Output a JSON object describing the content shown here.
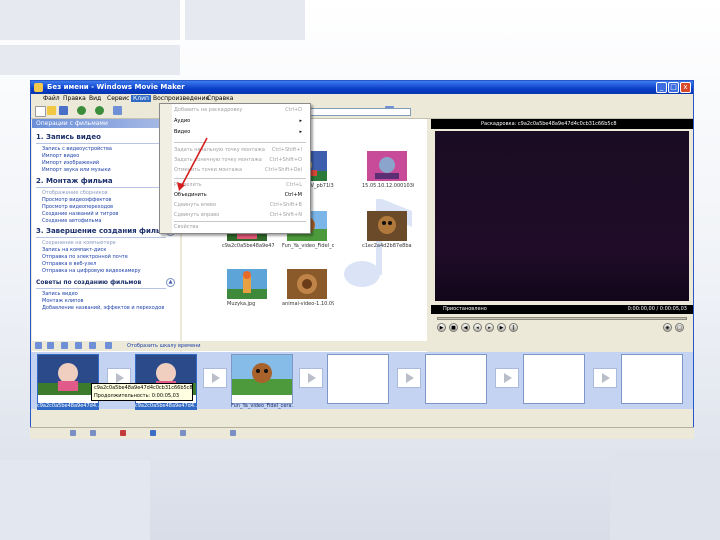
{
  "window": {
    "title": "Без имени - Windows Movie Maker",
    "buttons": [
      "_",
      "□",
      "x"
    ]
  },
  "menu": [
    "Файл",
    "Правка",
    "Вид",
    "Сервис",
    "Клип",
    "Воспроизведение",
    "Справка"
  ],
  "tasks": {
    "header": "Операции с фильмами",
    "sections": [
      {
        "title": "1. Запись видео",
        "items": [
          "Запись с видеоустройства",
          "Импорт видео",
          "Импорт изображений",
          "Импорт звука или музыки"
        ]
      },
      {
        "title": "2. Монтаж фильма",
        "items": [
          "Отображение сборников",
          "Просмотр видеоэффектов",
          "Просмотр видеопереходов",
          "Создание названий и титров",
          "Создание автофильма"
        ]
      },
      {
        "title": "3. Завершение создания фильма",
        "items": [
          "Сохранение на компьютере",
          "Запись на компакт-диск",
          "Отправка по электронной почте",
          "Отправка в веб-узел",
          "Отправка на цифровую видеокамеру"
        ]
      },
      {
        "title": "Советы по созданию фильмов",
        "items": [
          "Запись видео",
          "Монтаж клипов",
          "Добавление названий, эффектов и переходов"
        ]
      }
    ]
  },
  "dropdown": {
    "items": [
      {
        "label": "Добавить на раскадровку",
        "shortcut": "Ctrl+D",
        "disabled": true
      },
      {
        "label": "Аудио",
        "shortcut": "▸",
        "disabled": false
      },
      {
        "label": "Видео",
        "shortcut": "▸",
        "disabled": false
      },
      {
        "label": "Задать начальную точку монтажа",
        "shortcut": "Ctrl+Shift+I",
        "disabled": true
      },
      {
        "label": "Задать конечную точку монтажа",
        "shortcut": "Ctrl+Shift+O",
        "disabled": true
      },
      {
        "label": "Отменить точки монтажа",
        "shortcut": "Ctrl+Shift+Del",
        "disabled": true
      },
      {
        "label": "Разделить",
        "shortcut": "Ctrl+L",
        "disabled": true
      },
      {
        "label": "Объединить",
        "shortcut": "Ctrl+M",
        "disabled": false
      },
      {
        "label": "Сдвинуть влево",
        "shortcut": "Ctrl+Shift+B",
        "disabled": true
      },
      {
        "label": "Сдвинуть вправо",
        "shortcut": "Ctrl+Shift+N",
        "disabled": true
      },
      {
        "label": "Свойства",
        "shortcut": "",
        "disabled": true
      }
    ]
  },
  "collection": {
    "clips": [
      {
        "label": "sQoN2bV0LV_pb71l3_pl"
      },
      {
        "label": "15.05.10.12.00010303"
      },
      {
        "label": "c9a2c0a5be48a9e47d4c0cb31c66"
      },
      {
        "label": "Fun_Ya_video_Fidel_ch3"
      },
      {
        "label": "c1ec2a4d2b87e8ba"
      },
      {
        "label": "Muzyka.jpg"
      },
      {
        "label": "animal-video-1.10.09"
      }
    ]
  },
  "monitor": {
    "title": "Раскадровка: c9a2c0a5be48a9e47d4c0cb31c66b5c8",
    "status": "Приостановлено",
    "time": "0:00:00,00 / 0:00:05,03",
    "progress": 0
  },
  "storyboard": {
    "link": "Отобразить шкалу времени",
    "clips": [
      {
        "caption": "c9a2c0a5be48a9e47d4..."
      },
      {
        "caption": "c9a2c0a5be48a9e47d4..."
      },
      {
        "caption": "Fun_Ya_video_Fidel_cera..."
      }
    ]
  },
  "tooltip": {
    "line1": "c9a2c0a5be48a9e47d4c0cb31c66b5c8",
    "line2": "Продолжительность: 0:00:05,03"
  },
  "colors": {
    "titlebar": "#0a3ec8",
    "menu_highlight": "#316ac5",
    "storyboard_bg": "#c3d3f1",
    "arrow": "#d61f1f"
  }
}
